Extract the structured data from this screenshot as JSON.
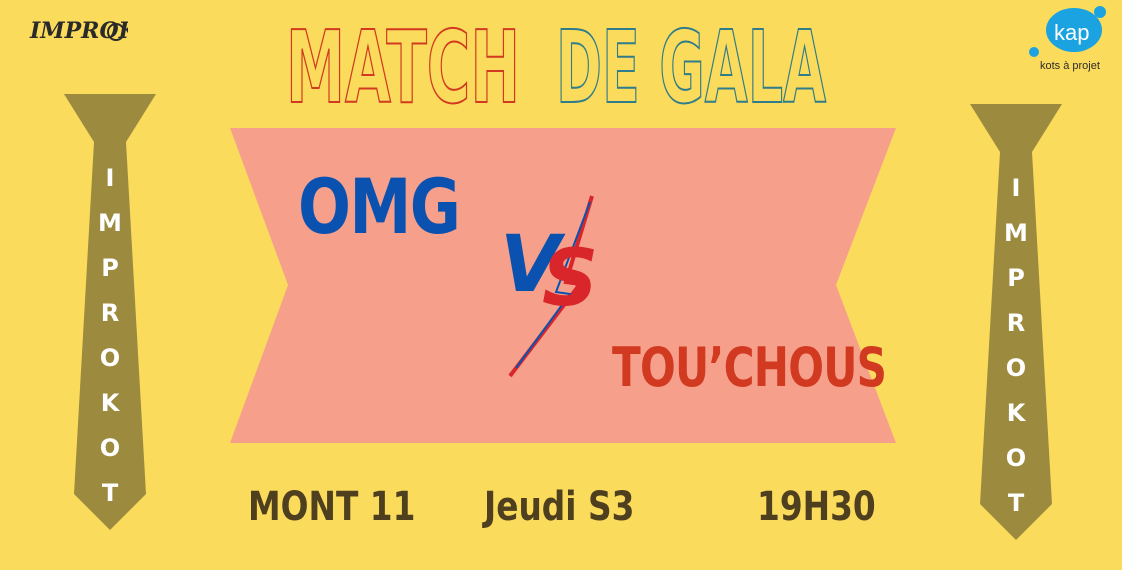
{
  "title": {
    "part1": "MATCH",
    "part2": "DE GALA"
  },
  "logos": {
    "left_logo_text": "IMPROKOT",
    "right_logo_text": "kap",
    "right_logo_caption": "kots à projet"
  },
  "ties": {
    "left_letters": [
      "I",
      "M",
      "P",
      "R",
      "O",
      "K",
      "O",
      "T"
    ],
    "right_letters": [
      "I",
      "M",
      "P",
      "R",
      "O",
      "K",
      "O",
      "T"
    ]
  },
  "match": {
    "team_left": "OMG",
    "versus_v": "V",
    "versus_s": "S",
    "team_right": "TOU’CHOUS"
  },
  "info": {
    "place": "MONT 11",
    "day": "Jeudi S3",
    "time": "19H30"
  },
  "colors": {
    "background": "#fbdb5c",
    "banner": "#f6a08c",
    "blue": "#0b52b0",
    "red": "#d13a20",
    "tie": "#9c8a3e",
    "text": "#4e3f1f"
  }
}
